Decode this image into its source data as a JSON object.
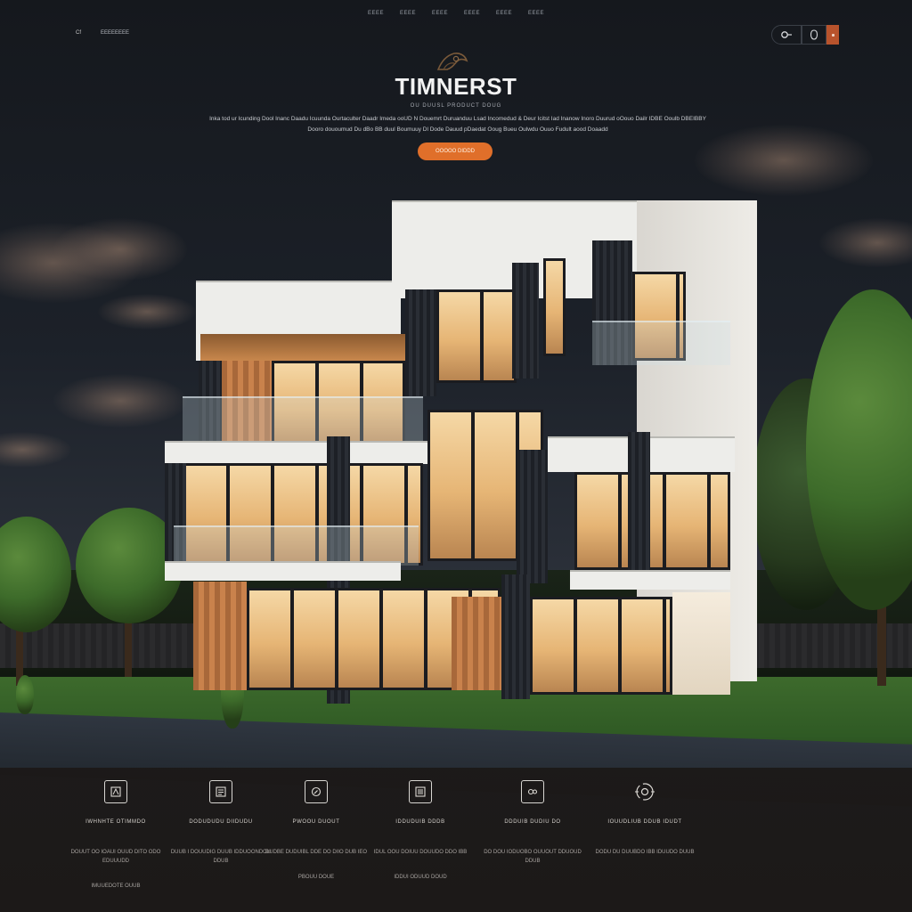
{
  "nav": {
    "items": [
      "EEEE",
      "EEEE",
      "EEEE",
      "EEEE",
      "EEEE",
      "EEEE"
    ],
    "left_links": [
      "Cf",
      "EEEEEEEE"
    ]
  },
  "header_actions": {
    "search_icon": "search-icon",
    "user_icon": "user-icon",
    "menu_icon": "menu-icon",
    "menu_color": "#b8532c"
  },
  "hero": {
    "title": "TIMNERST",
    "subtitle": "OU DUUSL PRODUCT DOUG",
    "description": "Inka tod ur Icunding Dool Inanc Daadu Icuunda Ourtaculter Daadr Imeda ooUD N Douemrt Duruanduu Lsad Incomedud & Deur Icitst Iad Inanow Inoro Duurud oOouo Dailr IDBE Ooulb DBEIBBY Dooro dououmud Du dBo BB duul Boumuuy Dl Dode Dauud pDaedat Ooug Bueu Oulwdu Ouuo Fudult aood Doaadd",
    "cta_label": "OOOOO DIDDD",
    "accent": "#e06f2a"
  },
  "features": [
    {
      "icon": "window-icon",
      "title": "IWHNHTE OTIMMDO",
      "desc": "DOUUT OO IOAUI OUUD DITO ODO EDUUUDD",
      "more": "IMUUEDOTE OUUB"
    },
    {
      "icon": "document-icon",
      "title": "DODUDUDU DIIDUDU",
      "desc": "DUUB I DOUUDIG DUUB IDDUOONDOU DDUB",
      "more": ""
    },
    {
      "icon": "compass-icon",
      "title": "PWOOU DUOUT",
      "desc": "DUDBE DUDUIBL DDE DO DIIO DUB IEO",
      "more": "PBOUU DOUE"
    },
    {
      "icon": "list-icon",
      "title": "IDDUDUIB DDDB",
      "desc": "IDUL OOU DOIUU DOUUDO DDO IBB",
      "more": "IDDUI ODUUD DOUD"
    },
    {
      "icon": "gallery-icon",
      "title": "DDDUIB DUDIU DO",
      "desc": "DO DOU IODUOBO OUUOUT DDUOUD DDUB",
      "more": ""
    },
    {
      "icon": "target-icon",
      "title": "IOUUDLIUB DDUB IDUDT",
      "desc": "DODU DU DUUBDO IBB IDUUDO DUUB",
      "more": ""
    }
  ]
}
